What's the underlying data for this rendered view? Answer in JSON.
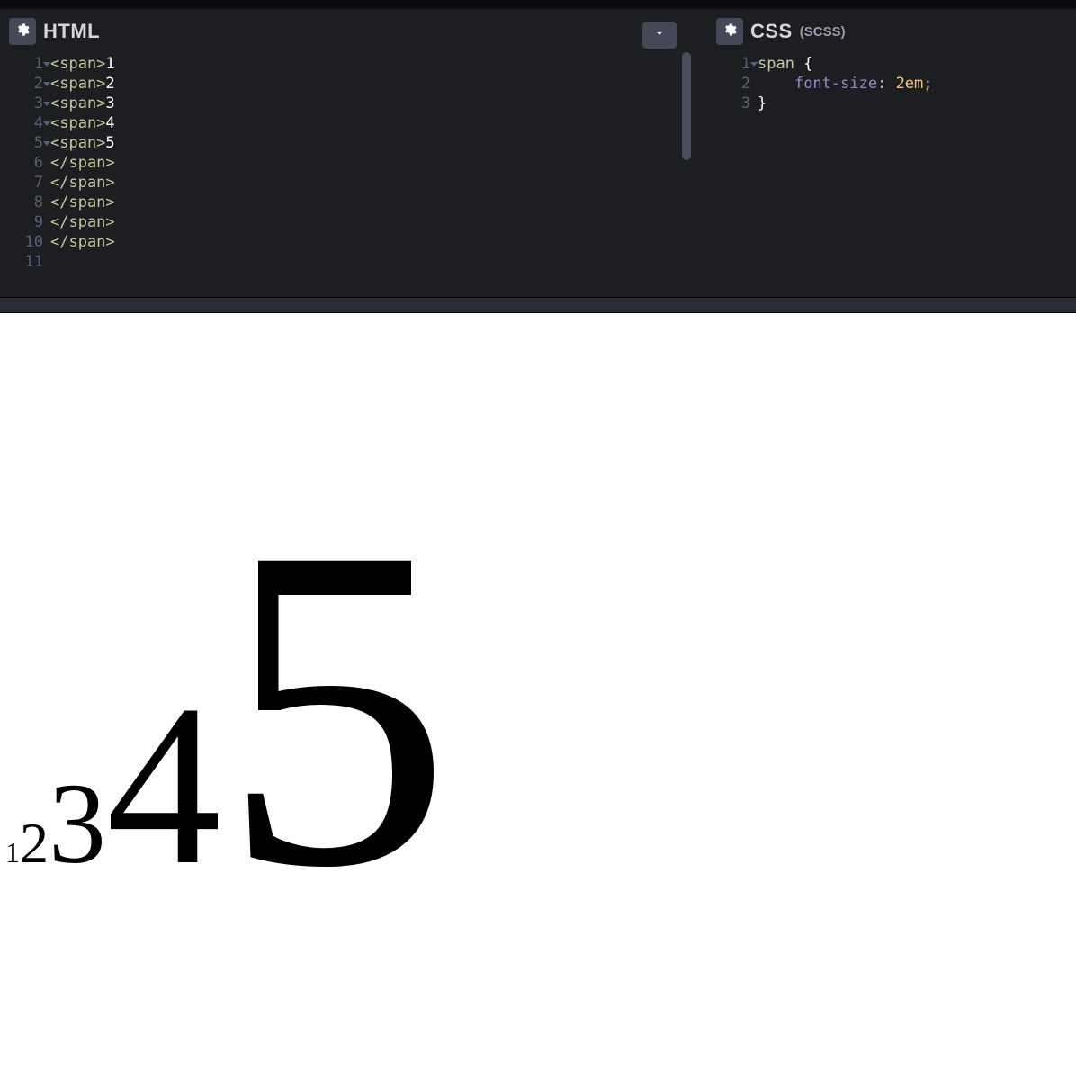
{
  "panels": {
    "html": {
      "title": "HTML",
      "lines": [
        {
          "n": "1",
          "fold": true,
          "tag": "<span>",
          "text": "1"
        },
        {
          "n": "2",
          "fold": true,
          "tag": "<span>",
          "text": "2"
        },
        {
          "n": "3",
          "fold": true,
          "tag": "<span>",
          "text": "3"
        },
        {
          "n": "4",
          "fold": true,
          "tag": "<span>",
          "text": "4"
        },
        {
          "n": "5",
          "fold": true,
          "tag": "<span>",
          "text": "5"
        },
        {
          "n": "6",
          "fold": false,
          "tag": "</span>",
          "text": ""
        },
        {
          "n": "7",
          "fold": false,
          "tag": "</span>",
          "text": ""
        },
        {
          "n": "8",
          "fold": false,
          "tag": "</span>",
          "text": ""
        },
        {
          "n": "9",
          "fold": false,
          "tag": "</span>",
          "text": ""
        },
        {
          "n": "10",
          "fold": false,
          "tag": "</span>",
          "text": ""
        },
        {
          "n": "11",
          "fold": false,
          "tag": "",
          "text": ""
        }
      ]
    },
    "css": {
      "title": "CSS",
      "subtitle": "(SCSS)",
      "lines": [
        {
          "n": "1",
          "fold": true,
          "tokens": [
            {
              "cls": "tok-sel",
              "t": "span "
            },
            {
              "cls": "tok-brace",
              "t": "{"
            }
          ]
        },
        {
          "n": "2",
          "fold": false,
          "tokens": [
            {
              "cls": "",
              "t": "    "
            },
            {
              "cls": "tok-prop",
              "t": "font-size"
            },
            {
              "cls": "tok-punct",
              "t": ": "
            },
            {
              "cls": "tok-val",
              "t": "2em"
            },
            {
              "cls": "tok-punct",
              "t": ";"
            }
          ]
        },
        {
          "n": "3",
          "fold": false,
          "tokens": [
            {
              "cls": "tok-brace",
              "t": "}"
            }
          ]
        }
      ]
    }
  },
  "output": {
    "n1": "1",
    "n2": "2",
    "n3": "3",
    "n4": "4",
    "n5": "5"
  }
}
